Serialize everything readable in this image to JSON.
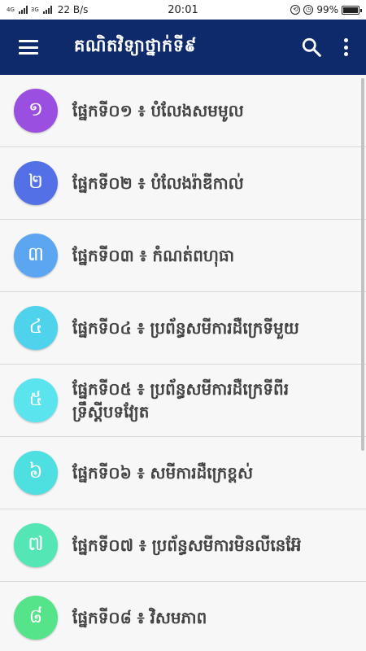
{
  "status_bar": {
    "network_label": "4G",
    "network_label_2": "3G",
    "speed": "22 B/s",
    "time": "20:01",
    "battery": "99%",
    "battery_level": 0.99
  },
  "app_bar": {
    "title": "គណិតវិទ្យាថ្នាក់ទី៩",
    "menu_icon": "hamburger-menu-icon",
    "search_icon": "search-icon",
    "more_icon": "more-vert-icon"
  },
  "chapters": [
    {
      "number": "១",
      "title": "ផ្នែកទី០១ ៖ បំលែងសមមូល",
      "color": "#9b4fe0"
    },
    {
      "number": "២",
      "title": "ផ្នែកទី០២ ៖ បំលែងរ៉ាឌីកាល់",
      "color": "#5470e6"
    },
    {
      "number": "៣",
      "title": "ផ្នែកទី០៣ ៖ កំណត់ពហុធា",
      "color": "#5ca6f1"
    },
    {
      "number": "៤",
      "title": "ផ្នែកទី០៤ ៖ ប្រព័ន្ធសមីការដឺក្រេទីមួយ",
      "color": "#4fd3ec"
    },
    {
      "number": "៥",
      "title": "ផ្នែកទី០៥ ៖ ប្រព័ន្ធសមីការដឺក្រេទីពីរ ទ្រឹស្តីបទវ្យែត",
      "color": "#5ae4ee"
    },
    {
      "number": "៦",
      "title": "ផ្នែកទី០៦ ៖ សមីការដឺក្រេខ្ពស់",
      "color": "#4edfe0"
    },
    {
      "number": "៧",
      "title": "ផ្នែកទី០៧ ៖ ប្រព័ន្ធសមីការមិនលីនេអ៊ែ",
      "color": "#54e6b4"
    },
    {
      "number": "៨",
      "title": "ផ្នែកទី០៨ ៖ វិសមភាព",
      "color": "#56e48a"
    }
  ]
}
